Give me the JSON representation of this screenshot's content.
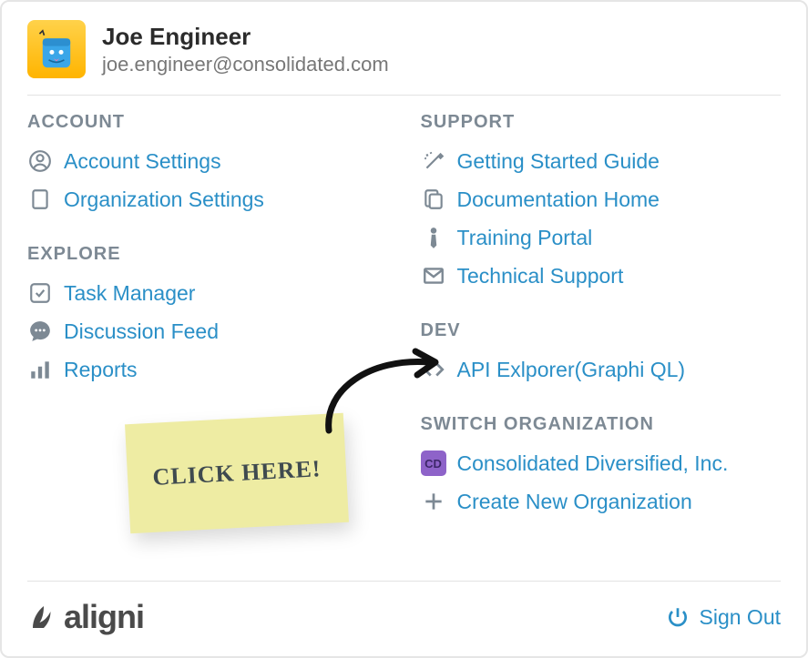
{
  "user": {
    "name": "Joe Engineer",
    "email": "joe.engineer@consolidated.com"
  },
  "sections": {
    "account": {
      "title": "ACCOUNT",
      "items": [
        {
          "label": "Account Settings"
        },
        {
          "label": "Organization Settings"
        }
      ]
    },
    "explore": {
      "title": "EXPLORE",
      "items": [
        {
          "label": "Task Manager"
        },
        {
          "label": "Discussion Feed"
        },
        {
          "label": "Reports"
        }
      ]
    },
    "support": {
      "title": "SUPPORT",
      "items": [
        {
          "label": "Getting Started Guide"
        },
        {
          "label": "Documentation Home"
        },
        {
          "label": "Training Portal"
        },
        {
          "label": "Technical Support"
        }
      ]
    },
    "dev": {
      "title": "DEV",
      "items": [
        {
          "label": "API Exlporer(Graphi QL)"
        }
      ]
    },
    "switch_org": {
      "title": "SWITCH ORGANIZATION",
      "org_badge": "CD",
      "items": [
        {
          "label": "Consolidated Diversified, Inc."
        },
        {
          "label": "Create New Organization"
        }
      ]
    }
  },
  "footer": {
    "brand": "aligni",
    "signout_label": "Sign Out"
  },
  "sticky_note": "CLICK HERE!"
}
